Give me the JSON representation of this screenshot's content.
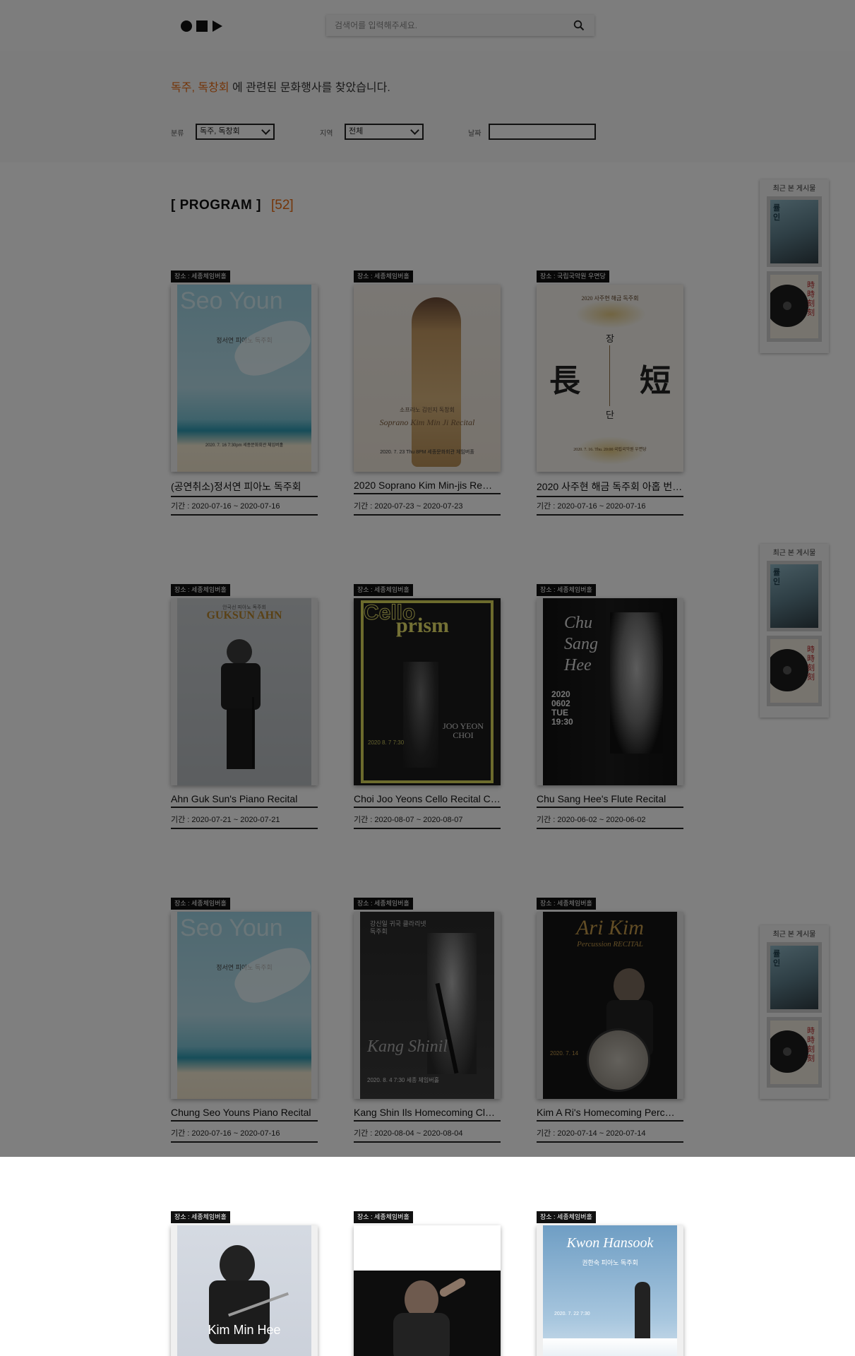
{
  "header": {
    "search_placeholder": "검색어를 입력해주세요."
  },
  "filters": {
    "result_keyword": "독주, 독창회",
    "result_suffix": " 에 관련된 문화행사를 찾았습니다.",
    "category_label": "분류",
    "category_value": "독주, 독창회",
    "region_label": "지역",
    "region_value": "전체",
    "date_label": "날짜",
    "date_value": ""
  },
  "program": {
    "title": "[ PROGRAM ]",
    "count": "[52]",
    "cards": [
      {
        "venue": "장소 : 세종체임버홀",
        "title": "(공연취소)정서연 피아노 독주회",
        "date": "기간 : 2020-07-16 ~ 2020-07-16"
      },
      {
        "venue": "장소 : 세종체임버홀",
        "title": "2020 Soprano Kim Min-jis Re…",
        "date": "기간 : 2020-07-23 ~ 2020-07-23"
      },
      {
        "venue": "장소 : 국립국악원 우면당",
        "title": "2020 사주현 해금 독주회 아홉 번…",
        "date": "기간 : 2020-07-16 ~ 2020-07-16"
      },
      {
        "venue": "장소 : 세종체임버홀",
        "title": "Ahn Guk Sun's Piano Recital",
        "date": "기간 : 2020-07-21 ~ 2020-07-21"
      },
      {
        "venue": "장소 : 세종체임버홀",
        "title": "Choi Joo Yeons Cello Recital C…",
        "date": "기간 : 2020-08-07 ~ 2020-08-07"
      },
      {
        "venue": "장소 : 세종체임버홀",
        "title": "Chu Sang Hee's Flute Recital",
        "date": "기간 : 2020-06-02 ~ 2020-06-02"
      },
      {
        "venue": "장소 : 세종체임버홀",
        "title": "Chung Seo Youns Piano Recital",
        "date": "기간 : 2020-07-16 ~ 2020-07-16"
      },
      {
        "venue": "장소 : 세종체임버홀",
        "title": "Kang Shin Ils Homecoming Cl…",
        "date": "기간 : 2020-08-04 ~ 2020-08-04"
      },
      {
        "venue": "장소 : 세종체임버홀",
        "title": "Kim A Ri's Homecoming Perc…",
        "date": "기간 : 2020-07-14 ~ 2020-07-14"
      },
      {
        "venue": "장소 : 세종체임버홀",
        "title": "",
        "date": ""
      },
      {
        "venue": "장소 : 세종체임버홀",
        "title": "",
        "date": ""
      },
      {
        "venue": "장소 : 세종체임버홀",
        "title": "",
        "date": ""
      }
    ],
    "poster_text": {
      "p1_big": "Seo Youn",
      "p1_sub": "정서연 피아노 독주회",
      "p1_date": "2020. 7. 16 7:30pm 세종문화회관 체임버홀",
      "p2_sub": "소프라노 김민지 독창회",
      "p2_script": "Soprano Kim Min Ji Recital",
      "p2_date": "2020. 7. 23 Thu 8PM 세종문화회관 체임버홀",
      "p3_top": "2020 사주현 해금 독주회",
      "p3_big1": "長",
      "p3_big2": "短",
      "p3_v1": "장",
      "p3_v2": "단",
      "p3_date": "2020. 7. 16. Thu. 20:00 국립국악원 우면당",
      "p4_big": "GUKSUN AHN",
      "p4_sub": "안국선 피아노 독주회",
      "p5_big1": "Cello",
      "p5_big2": "prism",
      "p5_name": "JOO YEON CHOI",
      "p5_date": "2020 8. 7 7:30",
      "p6_script": "Chu Sang Hee",
      "p6_date": "2020 0602 TUE 19:30",
      "p7_big": "Seo Youn",
      "p7_sub": "정서연 피아노 독주회",
      "p8_sub": "강신일 귀국 클라리넷 독주회",
      "p8_script": "Kang Shinil",
      "p8_date": "2020. 8. 4 7:30 세종 체임버홀",
      "p9_script": "Ari Kim",
      "p9_sub": "Percussion RECITAL",
      "p9_date": "2020. 7. 14",
      "p10_name": "Kim Min Hee",
      "p12_script": "Kwon Hansook",
      "p12_sub": "권한숙 피아노 독주회",
      "p12_date": "2020. 7. 22 7:30"
    }
  },
  "recent": {
    "label": "최근 본 게시물",
    "thumb1_text": "률인",
    "thumb2_text": "時時刻刻"
  },
  "colors": {
    "accent": "#e86a12",
    "overlay": "rgba(0,0,0,0.5)"
  }
}
